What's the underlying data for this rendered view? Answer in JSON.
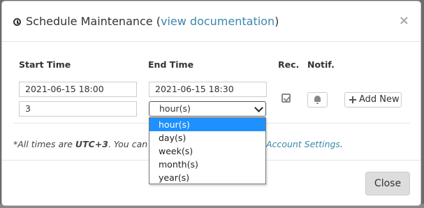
{
  "modal": {
    "title_prefix": "Schedule Maintenance (",
    "title_link": "view documentation",
    "title_suffix": ")",
    "close_symbol": "×",
    "icon": "clock-icon"
  },
  "columns": {
    "start_time": "Start Time",
    "end_time": "End Time",
    "rec": "Rec.",
    "notif": "Notif."
  },
  "form": {
    "start_value": "2021-06-15 18:00",
    "end_value": "2021-06-15 18:30",
    "duration_value": "3",
    "unit_selected": "hour(s)",
    "unit_options": [
      "hour(s)",
      "day(s)",
      "week(s)",
      "month(s)",
      "year(s)"
    ],
    "recurring_checked": true,
    "add_new_label": "Add New"
  },
  "note": {
    "prefix": "*All times are ",
    "timezone": "UTC+3",
    "suffix": ". You can c",
    "link": "Account Settings",
    "end": "."
  },
  "footer": {
    "close_label": "Close"
  },
  "colors": {
    "link": "#3a87ad",
    "selected_option": "#1e90ff"
  }
}
